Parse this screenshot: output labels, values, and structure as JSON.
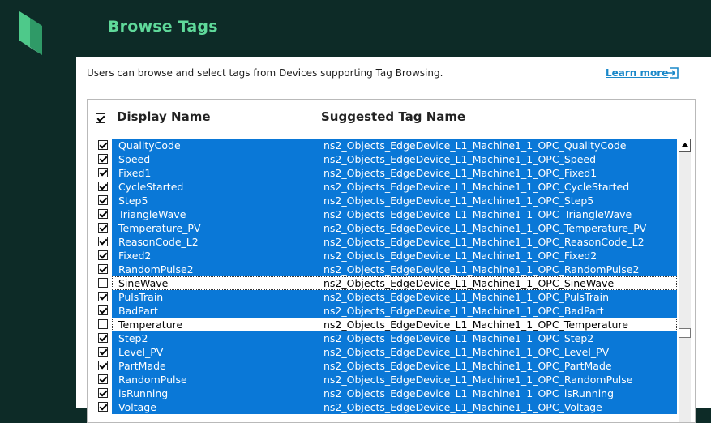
{
  "header": {
    "title": "Browse Tags"
  },
  "intro": {
    "text": "Users can browse and select tags from Devices supporting Tag Browsing.",
    "learn_more": "Learn more"
  },
  "table": {
    "columns": {
      "display": "Display Name",
      "suggested": "Suggested Tag Name"
    },
    "select_all_checked": true,
    "rows": [
      {
        "name": "QualityCode",
        "tag": "ns2_Objects_EdgeDevice_L1_Machine1_1_OPC_QualityCode",
        "checked": true
      },
      {
        "name": "Speed",
        "tag": "ns2_Objects_EdgeDevice_L1_Machine1_1_OPC_Speed",
        "checked": true
      },
      {
        "name": "Fixed1",
        "tag": "ns2_Objects_EdgeDevice_L1_Machine1_1_OPC_Fixed1",
        "checked": true
      },
      {
        "name": "CycleStarted",
        "tag": "ns2_Objects_EdgeDevice_L1_Machine1_1_OPC_CycleStarted",
        "checked": true
      },
      {
        "name": "Step5",
        "tag": "ns2_Objects_EdgeDevice_L1_Machine1_1_OPC_Step5",
        "checked": true
      },
      {
        "name": "TriangleWave",
        "tag": "ns2_Objects_EdgeDevice_L1_Machine1_1_OPC_TriangleWave",
        "checked": true
      },
      {
        "name": "Temperature_PV",
        "tag": "ns2_Objects_EdgeDevice_L1_Machine1_1_OPC_Temperature_PV",
        "checked": true
      },
      {
        "name": "ReasonCode_L2",
        "tag": "ns2_Objects_EdgeDevice_L1_Machine1_1_OPC_ReasonCode_L2",
        "checked": true
      },
      {
        "name": "Fixed2",
        "tag": "ns2_Objects_EdgeDevice_L1_Machine1_1_OPC_Fixed2",
        "checked": true
      },
      {
        "name": "RandomPulse2",
        "tag": "ns2_Objects_EdgeDevice_L1_Machine1_1_OPC_RandomPulse2",
        "checked": true
      },
      {
        "name": "SineWave",
        "tag": "ns2_Objects_EdgeDevice_L1_Machine1_1_OPC_SineWave",
        "checked": false
      },
      {
        "name": "PulsTrain",
        "tag": "ns2_Objects_EdgeDevice_L1_Machine1_1_OPC_PulsTrain",
        "checked": true
      },
      {
        "name": "BadPart",
        "tag": "ns2_Objects_EdgeDevice_L1_Machine1_1_OPC_BadPart",
        "checked": true
      },
      {
        "name": "Temperature",
        "tag": "ns2_Objects_EdgeDevice_L1_Machine1_1_OPC_Temperature",
        "checked": false
      },
      {
        "name": "Step2",
        "tag": "ns2_Objects_EdgeDevice_L1_Machine1_1_OPC_Step2",
        "checked": true
      },
      {
        "name": "Level_PV",
        "tag": "ns2_Objects_EdgeDevice_L1_Machine1_1_OPC_Level_PV",
        "checked": true
      },
      {
        "name": "PartMade",
        "tag": "ns2_Objects_EdgeDevice_L1_Machine1_1_OPC_PartMade",
        "checked": true
      },
      {
        "name": "RandomPulse",
        "tag": "ns2_Objects_EdgeDevice_L1_Machine1_1_OPC_RandomPulse",
        "checked": true
      },
      {
        "name": "isRunning",
        "tag": "ns2_Objects_EdgeDevice_L1_Machine1_1_OPC_isRunning",
        "checked": true
      },
      {
        "name": "Voltage",
        "tag": "ns2_Objects_EdgeDevice_L1_Machine1_1_OPC_Voltage",
        "checked": true
      }
    ]
  },
  "colors": {
    "topbar": "#0d2b27",
    "accent_green": "#5fd99a",
    "selection_blue": "#0a78d7",
    "link_blue": "#1a88c9"
  },
  "icons": {
    "logo": "brand-logo-icon",
    "learn_more": "external-link-icon",
    "scroll_up": "scroll-up-arrow-icon"
  }
}
